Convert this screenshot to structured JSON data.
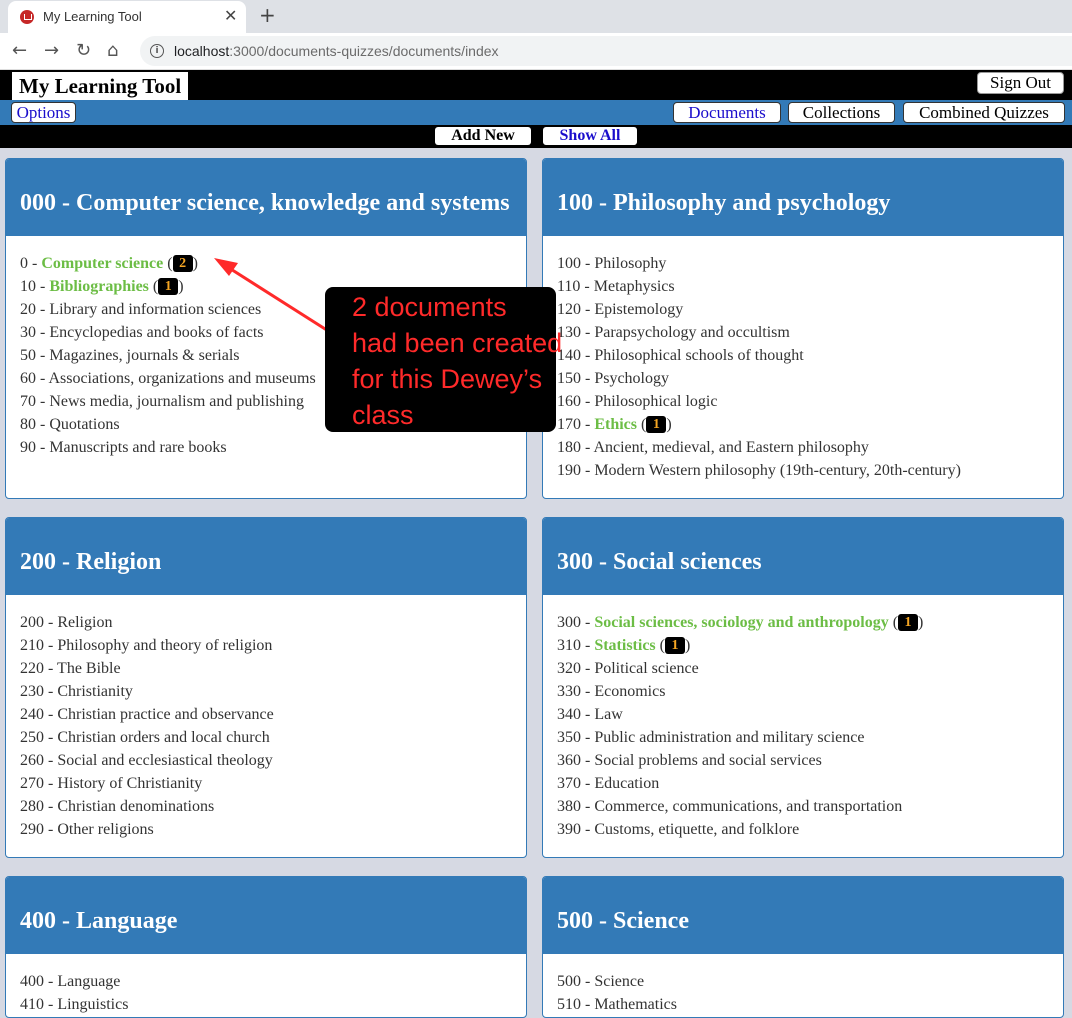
{
  "browser": {
    "tab_title": "My Learning Tool",
    "tab_close": "✕",
    "new_tab": "+",
    "url_host": "localhost",
    "url_rest": ":3000/documents-quizzes/documents/index",
    "back": "←",
    "forward": "→",
    "reload": "↻",
    "home": "⌂",
    "info": "i"
  },
  "header": {
    "title": "My Learning Tool",
    "sign_out": "Sign Out"
  },
  "menubar": {
    "options": "Options",
    "documents": "Documents",
    "collections": "Collections",
    "combined_quizzes": "Combined Quizzes"
  },
  "actions": {
    "add_new": "Add New",
    "show_all": "Show All"
  },
  "panels": [
    {
      "title": "000 - Computer science, knowledge and systems",
      "items": [
        {
          "code": "0 - ",
          "label": "Computer science",
          "count": "2"
        },
        {
          "code": "10 - ",
          "label": "Bibliographies",
          "count": "1"
        },
        {
          "text": "20 - Library and information sciences"
        },
        {
          "text": "30 - Encyclopedias and books of facts"
        },
        {
          "text": "50 - Magazines, journals & serials"
        },
        {
          "text": "60 - Associations, organizations and museums"
        },
        {
          "text": "70 - News media, journalism and publishing"
        },
        {
          "text": "80 - Quotations"
        },
        {
          "text": "90 - Manuscripts and rare books"
        }
      ]
    },
    {
      "title": "100 - Philosophy and psychology",
      "items": [
        {
          "text": "100 - Philosophy"
        },
        {
          "text": "110 - Metaphysics"
        },
        {
          "text": "120 - Epistemology"
        },
        {
          "text": "130 - Parapsychology and occultism"
        },
        {
          "text": "140 - Philosophical schools of thought"
        },
        {
          "text": "150 - Psychology"
        },
        {
          "text": "160 - Philosophical logic"
        },
        {
          "code": "170 - ",
          "label": "Ethics",
          "count": "1"
        },
        {
          "text": "180 - Ancient, medieval, and Eastern philosophy"
        },
        {
          "text": "190 - Modern Western philosophy (19th-century, 20th-century)"
        }
      ]
    },
    {
      "title": "200 - Religion",
      "items": [
        {
          "text": "200 - Religion"
        },
        {
          "text": "210 - Philosophy and theory of religion"
        },
        {
          "text": "220 - The Bible"
        },
        {
          "text": "230 - Christianity"
        },
        {
          "text": "240 - Christian practice and observance"
        },
        {
          "text": "250 - Christian orders and local church"
        },
        {
          "text": "260 - Social and ecclesiastical theology"
        },
        {
          "text": "270 - History of Christianity"
        },
        {
          "text": "280 - Christian denominations"
        },
        {
          "text": "290 - Other religions"
        }
      ]
    },
    {
      "title": "300 - Social sciences",
      "items": [
        {
          "code": "300 - ",
          "label": "Social sciences, sociology and anthropology",
          "count": "1"
        },
        {
          "code": "310 - ",
          "label": "Statistics",
          "count": "1"
        },
        {
          "text": "320 - Political science"
        },
        {
          "text": "330 - Economics"
        },
        {
          "text": "340 - Law"
        },
        {
          "text": "350 - Public administration and military science"
        },
        {
          "text": "360 - Social problems and social services"
        },
        {
          "text": "370 - Education"
        },
        {
          "text": "380 - Commerce, communications, and transportation"
        },
        {
          "text": "390 - Customs, etiquette, and folklore"
        }
      ]
    },
    {
      "title": "400 - Language",
      "items": [
        {
          "text": "400 - Language"
        },
        {
          "text": "410 - Linguistics"
        }
      ]
    },
    {
      "title": "500 - Science",
      "items": [
        {
          "text": "500 - Science"
        },
        {
          "text": "510 - Mathematics"
        }
      ]
    }
  ],
  "annotation": {
    "lines": [
      "2 documents",
      "had been created",
      "for this Dewey’s",
      "class"
    ],
    "color": "#ff2a2a"
  },
  "colors": {
    "primary": "#337ab7",
    "highlight": "#6cbd45",
    "badge_text": "#f5a623",
    "page_bg": "#d6d9e3"
  }
}
